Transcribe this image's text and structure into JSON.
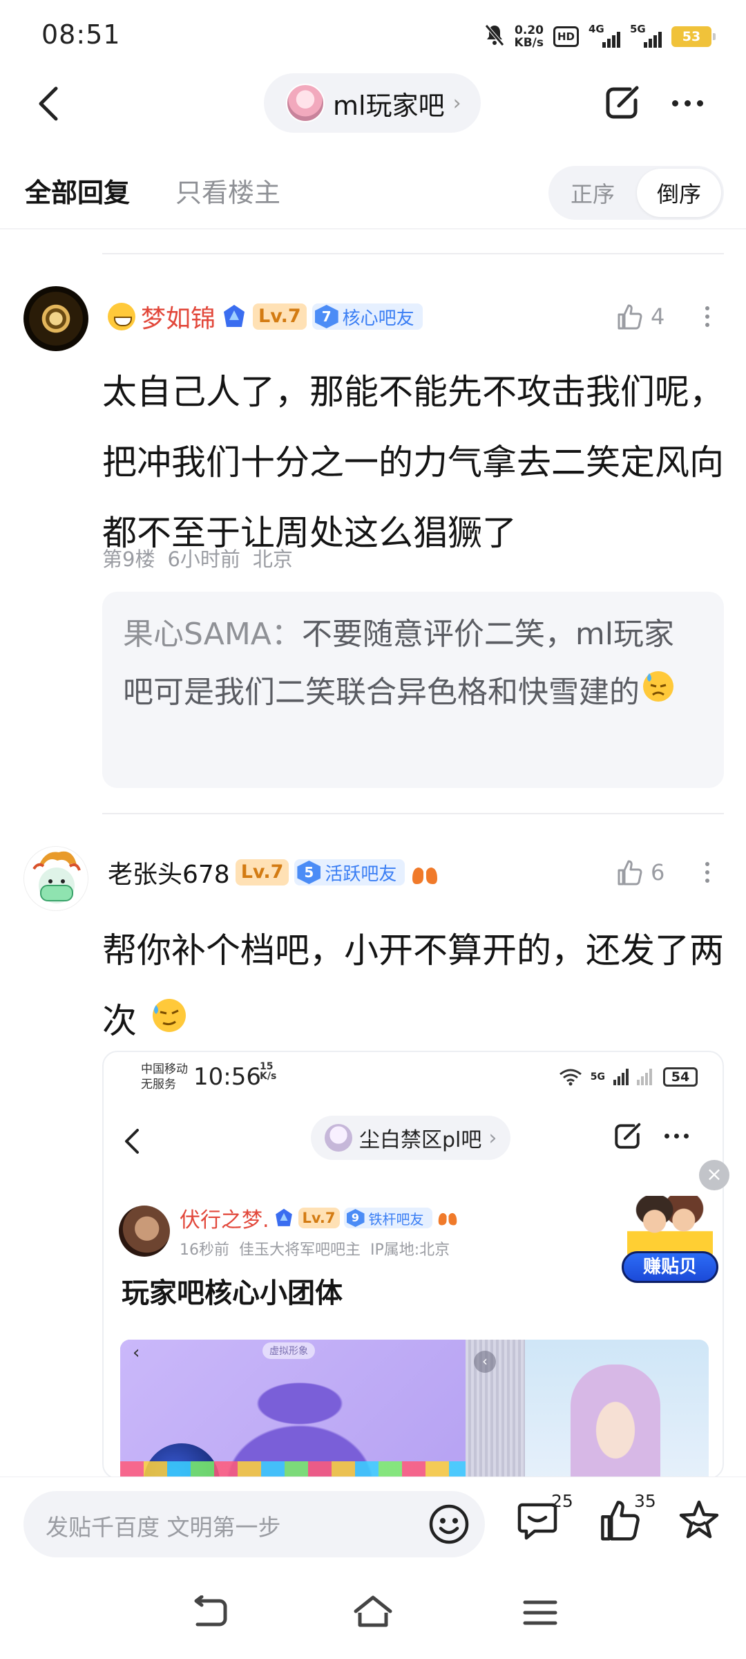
{
  "status_bar": {
    "time": "08:51",
    "net_speed_value": "0.20",
    "net_speed_unit": "KB/s",
    "hd_label": "HD",
    "signal_4g": "4G",
    "signal_5g": "5G",
    "battery": "53",
    "icons": [
      "mute-bell-icon",
      "hd-voice-icon",
      "signal-4g-icon",
      "signal-5g-icon",
      "battery-icon"
    ]
  },
  "header": {
    "forum_name": "ml玩家吧",
    "chevron": "›",
    "icons": [
      "back-arrow-icon",
      "share-icon",
      "more-icon"
    ]
  },
  "tabs": {
    "all_replies": "全部回复",
    "only_op": "只看楼主",
    "order_asc": "正序",
    "order_desc": "倒序"
  },
  "posts": [
    {
      "username": "梦如锦",
      "username_color": "#e2473a",
      "level": "Lv.7",
      "fan_level": "7",
      "fan_title": "核心吧友",
      "likes": "4",
      "text": "太自己人了，那能不能先不攻击我们呢，把冲我们十分之一的力气拿去二笑定风向都不至于让周处这么猖獗了",
      "floor": "第9楼",
      "time": "6小时前",
      "location": "北京",
      "quote": {
        "author": "果心SAMA：",
        "text": "不要随意评价二笑，ml玩家吧可是我们二笑联合异色格和快雪建的"
      }
    },
    {
      "username": "老张头678",
      "level": "Lv.7",
      "fan_level": "5",
      "fan_title": "活跃吧友",
      "likes": "6",
      "text": "帮你补个档吧，小开不算开的，还发了两次"
    }
  ],
  "embedded_screenshot": {
    "carrier_line1": "中国移动",
    "carrier_line2": "无服务",
    "time": "10:56",
    "speed_value": "15",
    "speed_unit": "K/s",
    "signal_5g": "5G",
    "battery": "54",
    "forum_name": "尘白禁区pl吧",
    "chevron": "›",
    "username": "伏行之梦.",
    "level": "Lv.7",
    "fan_level": "9",
    "fan_title": "铁杆吧友",
    "post_time": "16秒前",
    "role": "佳玉大将军吧吧主",
    "ip": "IP属地:北京",
    "title": "玩家吧核心小团体",
    "img_chip": "虚拟形象",
    "earn_label": "赚贴贝"
  },
  "bottom_bar": {
    "reply_placeholder": "发贴千百度 文明第一步",
    "comment_count": "25",
    "like_count": "35"
  },
  "accent_colors": {
    "red_name": "#e2473a",
    "blue_badge": "#3a7ef4",
    "level_orange": "#d37b12"
  }
}
